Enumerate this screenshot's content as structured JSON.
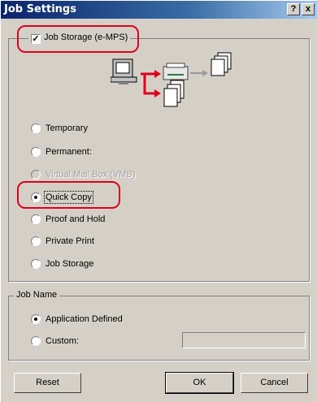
{
  "window": {
    "title": "Job Settings",
    "help_glyph": "?",
    "close_glyph": "x"
  },
  "job_storage": {
    "check_mark": "✓",
    "label": "Job Storage (e-MPS)",
    "checked": true,
    "options": [
      {
        "label": "Temporary",
        "checked": false,
        "enabled": true
      },
      {
        "label": "Permanent:",
        "checked": false,
        "enabled": true
      },
      {
        "label": "Virtual Mail Box (VMB)",
        "checked": false,
        "enabled": false
      },
      {
        "label": "Quick Copy",
        "checked": true,
        "enabled": true
      },
      {
        "label": "Proof and Hold",
        "checked": false,
        "enabled": true
      },
      {
        "label": "Private Print",
        "checked": false,
        "enabled": true
      },
      {
        "label": "Job Storage",
        "checked": false,
        "enabled": true
      }
    ]
  },
  "job_name": {
    "label": "Job Name",
    "options": [
      {
        "label": "Application Defined",
        "checked": true
      },
      {
        "label": "Custom:",
        "checked": false
      }
    ],
    "custom_value": ""
  },
  "buttons": {
    "reset": "Reset",
    "ok": "OK",
    "cancel": "Cancel"
  },
  "colors": {
    "highlight": "#e0001b",
    "titlebar": "#0a246a"
  }
}
